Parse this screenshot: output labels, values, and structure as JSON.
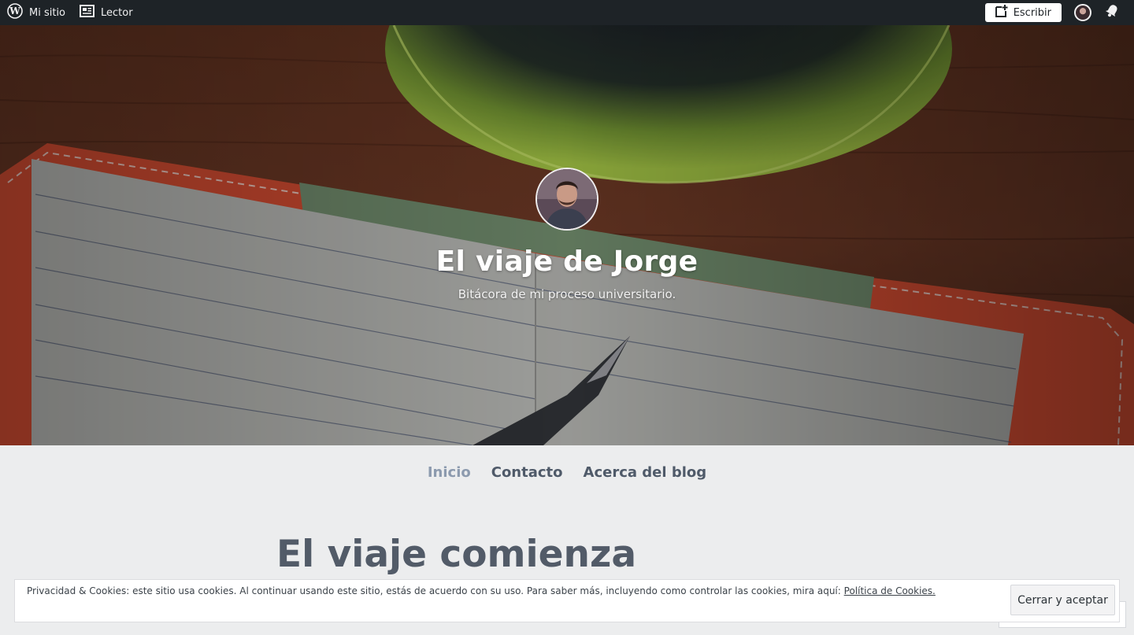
{
  "admin_bar": {
    "my_site_label": "Mi sitio",
    "reader_label": "Lector",
    "write_label": "Escribir"
  },
  "header": {
    "site_title": "El viaje de Jorge",
    "site_description": "Bitácora de mi proceso universitario."
  },
  "nav": {
    "items": [
      {
        "label": "Inicio",
        "current": true
      },
      {
        "label": "Contacto",
        "current": false
      },
      {
        "label": "Acerca del blog",
        "current": false
      }
    ]
  },
  "post": {
    "title": "El viaje comienza"
  },
  "cookie_banner": {
    "text": "Privacidad & Cookies: este sitio usa cookies. Al continuar usando este sitio, estás de acuerdo con su uso. Para saber más, incluyendo como controlar las cookies, mira aquí:",
    "link_label": "Política de Cookies.",
    "accept_label": "Cerrar y aceptar"
  },
  "colors": {
    "admin_bar_bg": "#1e2327",
    "nav_current": "#8c9aae",
    "nav_item": "#4f5a69",
    "page_bg": "#ecedee"
  }
}
